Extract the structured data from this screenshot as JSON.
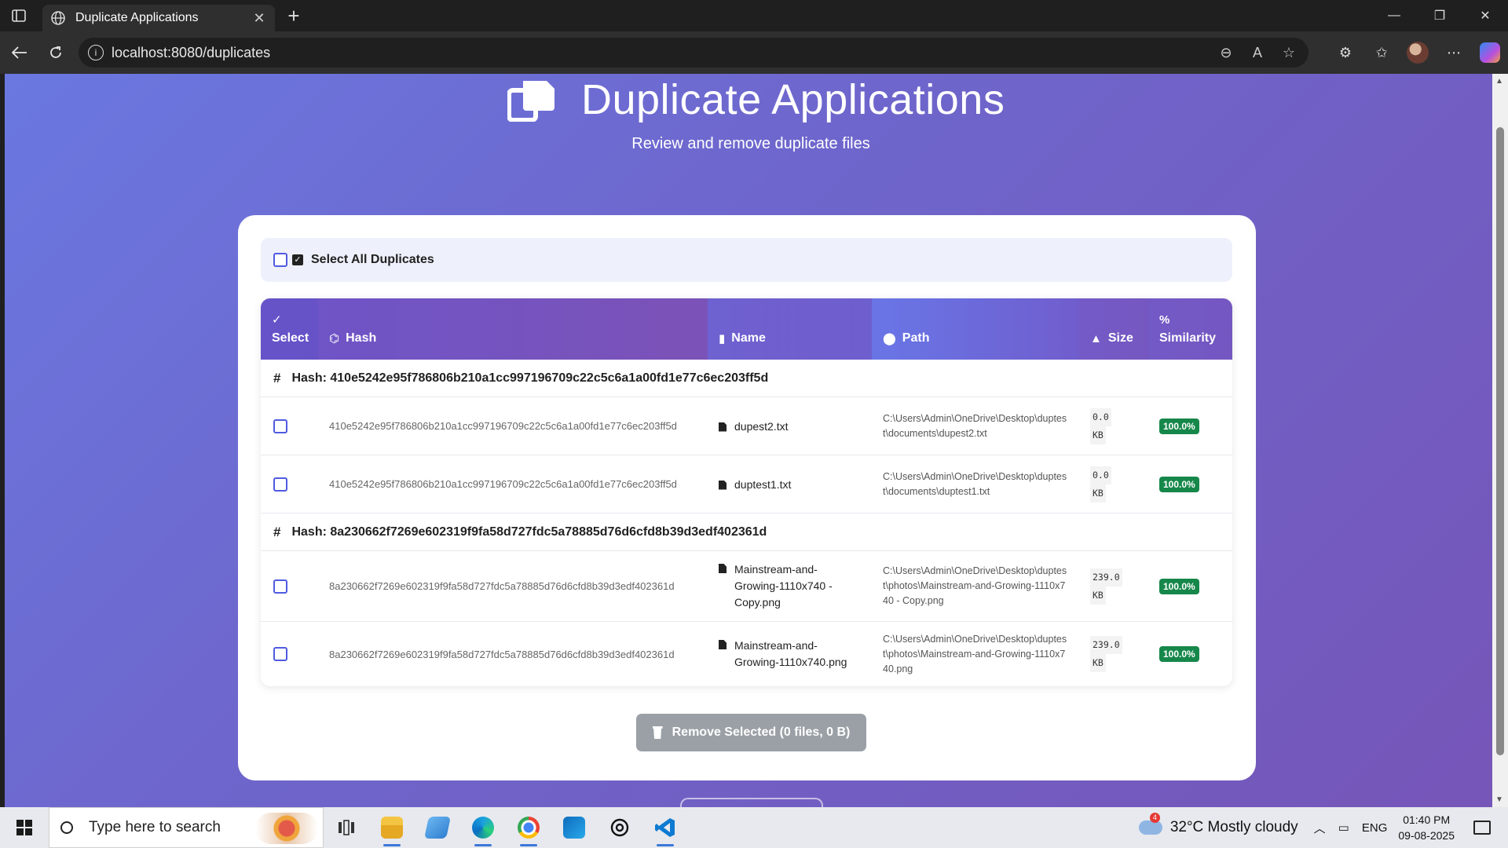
{
  "browser": {
    "tab_title": "Duplicate Applications",
    "url": "localhost:8080/duplicates"
  },
  "page": {
    "title": "Duplicate Applications",
    "subtitle": "Review and remove duplicate files",
    "select_all_label": "Select All Duplicates",
    "columns": {
      "select": "Select",
      "hash": "Hash",
      "name": "Name",
      "path": "Path",
      "size": "Size",
      "similarity": "Similarity"
    },
    "groups": [
      {
        "header": "Hash: 410e5242e95f786806b210a1cc997196709c22c5c6a1a00fd1e77c6ec203ff5d",
        "rows": [
          {
            "hash": "410e5242e95f786806b210a1cc997196709c22c5c6a1a00fd1e77c6ec203ff5d",
            "name": "dupest2.txt",
            "path": "C:\\Users\\Admin\\OneDrive\\Desktop\\duptest\\documents\\dupest2.txt",
            "size_value": "0.0",
            "size_unit": "KB",
            "similarity": "100.0%"
          },
          {
            "hash": "410e5242e95f786806b210a1cc997196709c22c5c6a1a00fd1e77c6ec203ff5d",
            "name": "duptest1.txt",
            "path": "C:\\Users\\Admin\\OneDrive\\Desktop\\duptest\\documents\\duptest1.txt",
            "size_value": "0.0",
            "size_unit": "KB",
            "similarity": "100.0%"
          }
        ]
      },
      {
        "header": "Hash: 8a230662f7269e602319f9fa58d727fdc5a78885d76d6cfd8b39d3edf402361d",
        "rows": [
          {
            "hash": "8a230662f7269e602319f9fa58d727fdc5a78885d76d6cfd8b39d3edf402361d",
            "name": "Mainstream-and-Growing-1110x740 - Copy.png",
            "path": "C:\\Users\\Admin\\OneDrive\\Desktop\\duptest\\photos\\Mainstream-and-Growing-1110x740 - Copy.png",
            "size_value": "239.0",
            "size_unit": "KB",
            "similarity": "100.0%"
          },
          {
            "hash": "8a230662f7269e602319f9fa58d727fdc5a78885d76d6cfd8b39d3edf402361d",
            "name": "Mainstream-and-Growing-1110x740.png",
            "path": "C:\\Users\\Admin\\OneDrive\\Desktop\\duptest\\photos\\Mainstream-and-Growing-1110x740.png",
            "size_value": "239.0",
            "size_unit": "KB",
            "similarity": "100.0%"
          }
        ]
      }
    ],
    "remove_button": "Remove Selected (0 files, 0 B)"
  },
  "taskbar": {
    "search_placeholder": "Type here to search",
    "weather_badge": "4",
    "weather": "32°C  Mostly cloudy",
    "lang": "ENG",
    "time": "01:40 PM",
    "date": "09-08-2025"
  },
  "colors": {
    "accent": "#6a64d8",
    "badge_green": "#16874a",
    "button_disabled": "#9aa0a6"
  }
}
